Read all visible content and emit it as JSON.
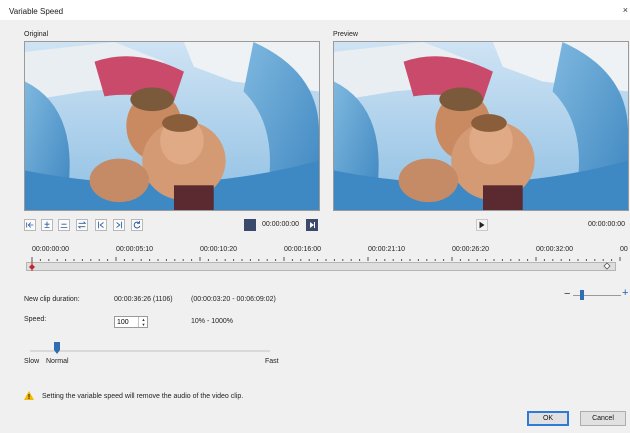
{
  "window": {
    "title": "Variable Speed",
    "close_glyph": "×"
  },
  "panels": {
    "original_label": "Original",
    "preview_label": "Preview"
  },
  "transport": {
    "original_timecode": "00:00:00:00",
    "preview_timecode": "00:00:00:00"
  },
  "toolbar_icons": [
    "mark-in-icon",
    "add-keyframe-icon",
    "remove-keyframe-icon",
    "reverse-icon",
    "previous-keyframe-icon",
    "next-keyframe-icon",
    "reset-icon"
  ],
  "ruler": {
    "labels": [
      "00:00:00:00",
      "00:00:05:10",
      "00:00:10:20",
      "00:00:16:00",
      "00:00:21:10",
      "00:00:26:20",
      "00:00:32:00",
      "00"
    ]
  },
  "clip": {
    "duration_label": "New clip duration:",
    "duration_value": "00:00:36:26 (1106)",
    "duration_range": "(00:00:03:20 - 00:06:09:02)"
  },
  "speed": {
    "label": "Speed:",
    "value": "100",
    "range": "10% - 1000%",
    "slider_slow": "Slow",
    "slider_normal": "Normal",
    "slider_fast": "Fast",
    "slider_position": 0.1
  },
  "zoom": {
    "minus": "−",
    "plus": "+"
  },
  "warning": {
    "text": "Setting the variable speed will remove the audio of the video clip."
  },
  "buttons": {
    "ok": "OK",
    "cancel": "Cancel"
  },
  "colors": {
    "accent": "#2f6db5",
    "marker_red": "#c0272d",
    "warning_yellow": "#f5b800",
    "water": "#5ea3cf"
  }
}
